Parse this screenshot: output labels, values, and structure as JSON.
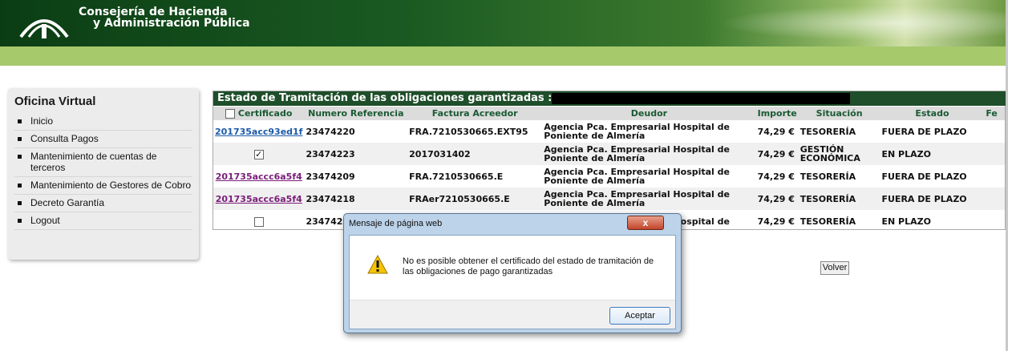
{
  "header": {
    "brand_line1": "Consejería de Hacienda",
    "brand_line2": "y Administración Pública"
  },
  "sidebar": {
    "title": "Oficina Virtual",
    "items": [
      {
        "label": "Inicio"
      },
      {
        "label": "Consulta Pagos"
      },
      {
        "label": "Mantenimiento de cuentas de terceros"
      },
      {
        "label": "Mantenimiento de Gestores de Cobro"
      },
      {
        "label": "Decreto Garantía"
      },
      {
        "label": "Logout"
      }
    ]
  },
  "table": {
    "title": "Estado de Tramitación de las obligaciones garantizadas :",
    "columns": [
      "Certificado",
      "Numero Referencia",
      "Factura Acreedor",
      "Deudor",
      "Importe",
      "Situación",
      "Estado",
      "Fe"
    ],
    "rows": [
      {
        "certificado": "201735acc93ed1f",
        "checkbox": null,
        "referencia": "23474220",
        "factura": "FRA.7210530665.EXT95",
        "deudor": "Agencia Pca. Empresarial Hospital de Poniente de Almería",
        "importe": "74,29 €",
        "situacion": "TESORERÍA",
        "estado": "FUERA DE PLAZO"
      },
      {
        "certificado": "",
        "checkbox": "✓",
        "referencia": "23474223",
        "factura": "2017031402",
        "deudor": "Agencia Pca. Empresarial Hospital de Poniente de Almería",
        "importe": "74,29 €",
        "situacion": "GESTIÓN ECONÓMICA",
        "estado": "EN PLAZO"
      },
      {
        "certificado": "201735accc6a5f4",
        "checkbox": null,
        "referencia": "23474209",
        "factura": "FRA.7210530665.E",
        "deudor": "Agencia Pca. Empresarial Hospital de Poniente de Almería",
        "importe": "74,29 €",
        "situacion": "TESORERÍA",
        "estado": "FUERA DE PLAZO"
      },
      {
        "certificado": "201735accc6a5f4",
        "checkbox": null,
        "referencia": "23474218",
        "factura": "FRAer7210530665.E",
        "deudor": "Agencia Pca. Empresarial Hospital de Poniente de Almería",
        "importe": "74,29 €",
        "situacion": "TESORERÍA",
        "estado": "FUERA DE PLAZO"
      },
      {
        "certificado": "",
        "checkbox": "",
        "referencia": "2347422",
        "factura": "",
        "deudor": "Agencia Pca. Empresarial Hospital de",
        "importe": "74,29 €",
        "situacion": "TESORERÍA",
        "estado": "EN PLAZO"
      }
    ]
  },
  "volver_label": "Volver",
  "dialog": {
    "title": "Mensaje de página web",
    "close": "x",
    "message": "No es posible obtener el certificado del estado de tramitación de las obligaciones de pago garantizadas",
    "ok_label": "Aceptar"
  }
}
